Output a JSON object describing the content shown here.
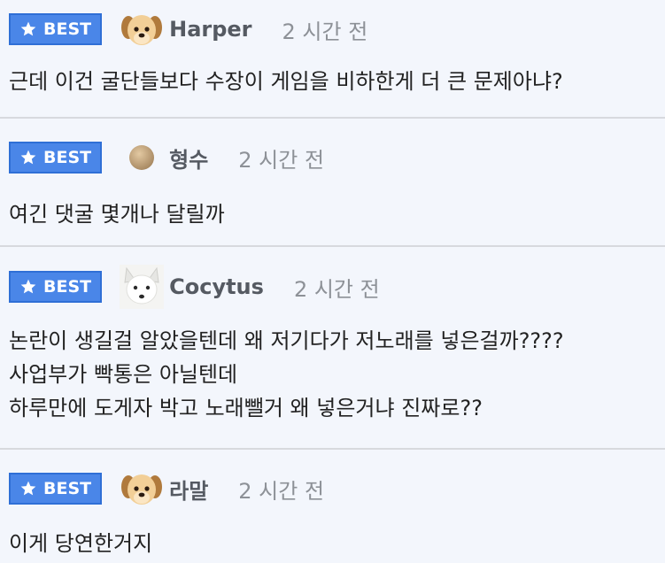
{
  "comments": [
    {
      "badge": "BEST",
      "avatar": "puppy-avatar-icon",
      "username": "Harper",
      "time": "2 시간 전",
      "lines": [
        "근데 이건 굴단들보다 수장이 게임을 비하한게 더 큰 문제아냐?"
      ]
    },
    {
      "badge": "BEST",
      "avatar": "beige-circle-avatar-icon",
      "username": "형수",
      "time": "2 시간 전",
      "lines": [
        "여긴 댓굴 몇개나 달릴까"
      ]
    },
    {
      "badge": "BEST",
      "avatar": "white-fox-avatar-icon",
      "username": "Cocytus",
      "time": "2 시간 전",
      "lines": [
        "논란이 생길걸 알았을텐데 왜 저기다가 저노래를 넣은걸까????",
        "사업부가 빡통은 아닐텐데",
        "하루만에 도게자 박고 노래뺄거 왜 넣은거냐 진짜로??"
      ]
    },
    {
      "badge": "BEST",
      "avatar": "puppy-avatar-icon",
      "username": "라말",
      "time": "2 시간 전",
      "lines": [
        "이게 당연한거지"
      ]
    }
  ],
  "colors": {
    "background": "#f3f6fc",
    "badge": "#4a86e8",
    "username": "#555a62",
    "timestamp": "#8d9197",
    "text": "#222222",
    "divider": "#d7d9de"
  }
}
